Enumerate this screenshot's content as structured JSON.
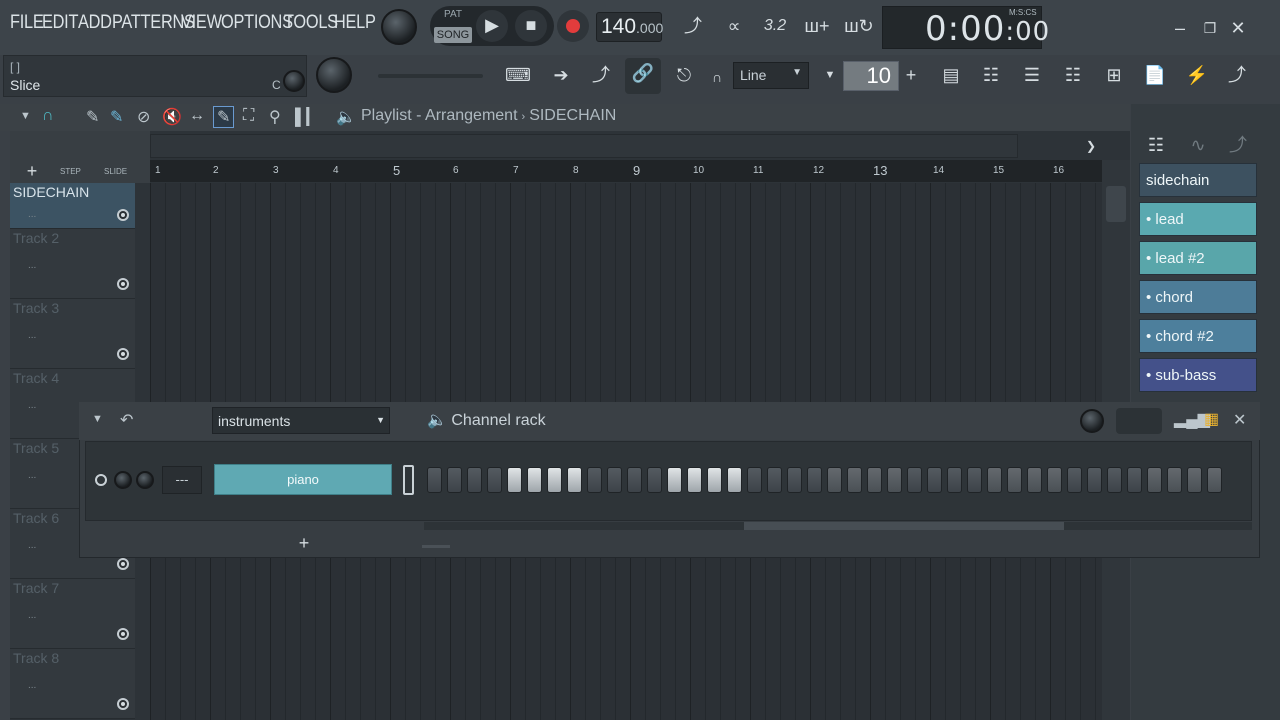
{
  "menu": [
    "FILE",
    "EDIT",
    "ADD",
    "PATTERNS",
    "VIEW",
    "OPTIONS",
    "TOOLS",
    "HELP"
  ],
  "hint": {
    "brackets": "[  ]",
    "text": "Slice",
    "note": "C"
  },
  "transport": {
    "pat": "PAT",
    "song": "SONG",
    "bpm": "140",
    "bpm_fraction": ".000"
  },
  "time": {
    "value": "0:00",
    "sub": ":00",
    "unit": "M:S:CS"
  },
  "snap": {
    "mode": "Line",
    "value": "10"
  },
  "playlist": {
    "title": "Playlist - Arrangement",
    "separator": "›",
    "pattern": "SIDECHAIN",
    "step_label": "STEP",
    "slide_label": "SLIDE",
    "add_label": "+"
  },
  "ruler": [
    "1",
    "2",
    "3",
    "4",
    "5",
    "6",
    "7",
    "8",
    "9",
    "10",
    "11",
    "12",
    "13",
    "14",
    "15",
    "16"
  ],
  "tracks": [
    {
      "name": "SIDECHAIN",
      "selected": true
    },
    {
      "name": "Track 2"
    },
    {
      "name": "Track 3"
    },
    {
      "name": "Track 4"
    },
    {
      "name": "Track 5"
    },
    {
      "name": "Track 6"
    },
    {
      "name": "Track 7"
    },
    {
      "name": "Track 8"
    }
  ],
  "track_dots": "...",
  "patterns": [
    {
      "label": "sidechain",
      "color": "#3d5160"
    },
    {
      "label": "• lead",
      "color": "#5aa9b0"
    },
    {
      "label": "• lead #2",
      "color": "#59a6aa"
    },
    {
      "label": "• chord",
      "color": "#4d7c98"
    },
    {
      "label": "• chord #2",
      "color": "#4d7f9c"
    },
    {
      "label": "• sub-bass",
      "color": "#44518a"
    }
  ],
  "channelrack": {
    "group": "instruments",
    "title": "Channel rack",
    "channel": "piano",
    "route": "---",
    "add": "+",
    "steps": [
      0,
      0,
      0,
      0,
      1,
      1,
      1,
      1,
      0,
      0,
      0,
      0,
      1,
      1,
      1,
      1,
      0,
      0,
      0,
      0,
      0,
      0,
      0,
      0,
      0,
      0,
      0,
      0,
      0,
      0,
      0,
      0,
      0,
      0,
      0,
      0,
      0,
      0,
      0,
      0
    ]
  },
  "colors": {
    "accent": "#5fa9b3",
    "record": "#e23c3c"
  }
}
